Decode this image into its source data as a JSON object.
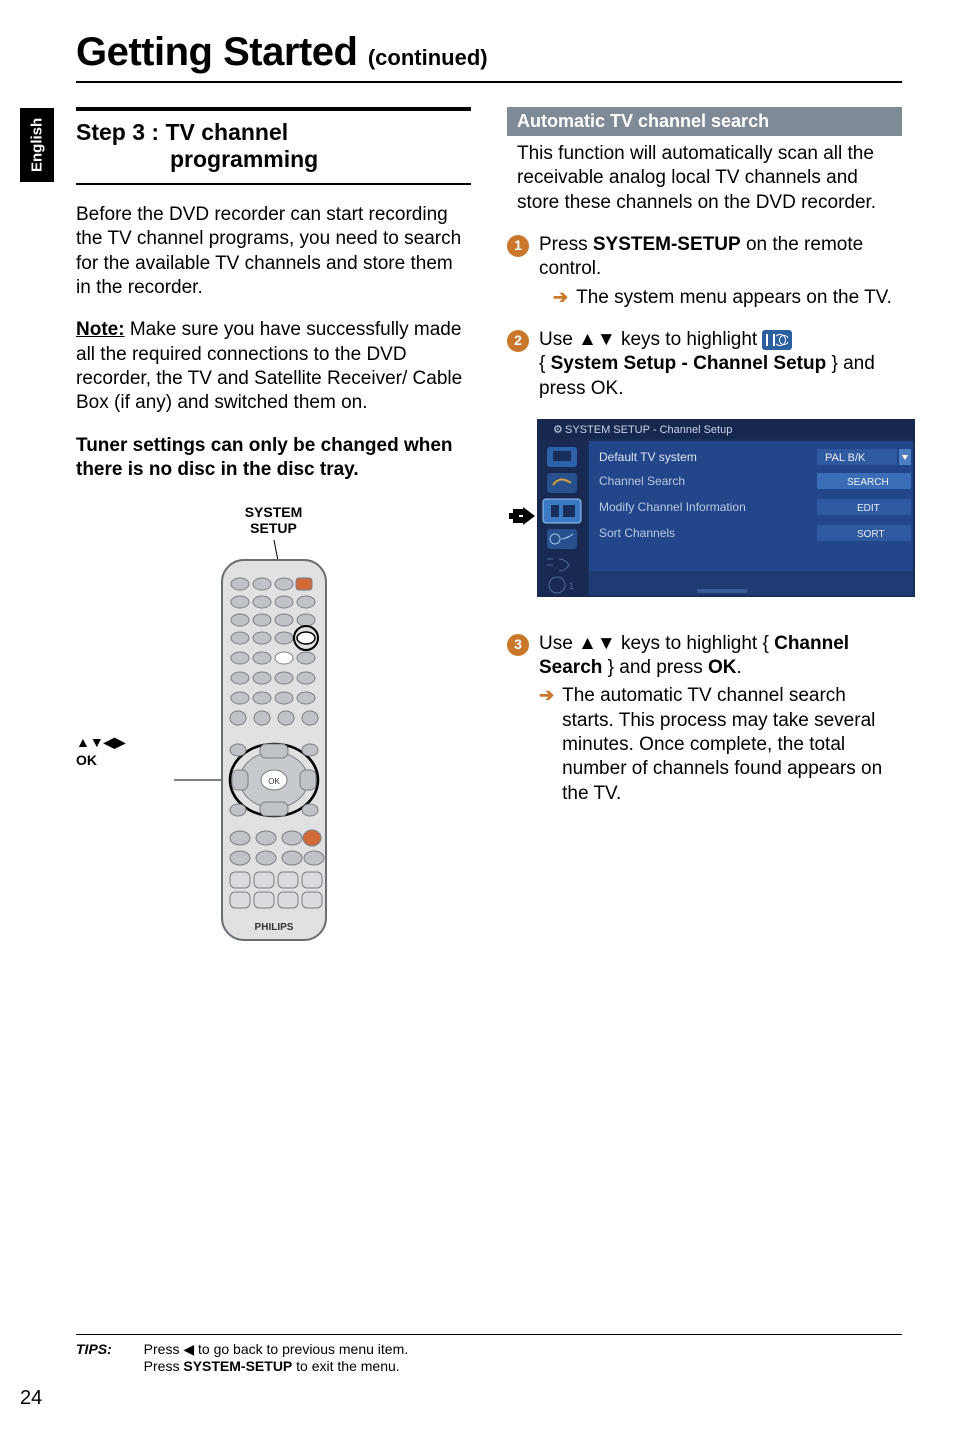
{
  "language_tab": "English",
  "title": {
    "main": "Getting Started",
    "continued": "(continued)"
  },
  "left": {
    "step_label_prefix": "Step 3 :",
    "step_title_1": "TV channel",
    "step_title_2": "programming",
    "intro": "Before the DVD recorder can start recording the TV channel programs, you need to search for the available TV channels and store them in the recorder.",
    "note_label": "Note:",
    "note_body": " Make sure you have successfully made all the required connections to the DVD recorder, the TV and Satellite Receiver/ Cable Box (if any) and switched them on.",
    "tuner_warning": "Tuner settings can only be changed when there is no disc in the disc tray.",
    "remote_top_label_1": "SYSTEM",
    "remote_top_label_2": "SETUP",
    "remote_left_label_1": "▲▼◀▶",
    "remote_left_label_2": "OK",
    "remote_brand": "PHILIPS"
  },
  "right": {
    "subheader": "Automatic TV channel search",
    "intro": "This function will automatically scan all the receivable analog local TV channels and store these channels on the DVD recorder.",
    "step1_a": "Press ",
    "step1_key": "SYSTEM-SETUP",
    "step1_b": " on the remote control.",
    "step1_result": "The system menu appears on the TV.",
    "step2_a": "Use ▲▼ keys to highlight ",
    "step2_b_prefix": "{ ",
    "step2_b_bold": "System Setup - Channel Setup",
    "step2_b_suffix": " } and press OK.",
    "step3_a": "Use ▲▼ keys to highlight { ",
    "step3_bold": "Channel Search",
    "step3_b": " } and press ",
    "step3_ok": "OK",
    "step3_c": ".",
    "step3_result": "The automatic TV channel search starts. This process may take several minutes. Once complete, the total number of channels found appears on the TV.",
    "menu": {
      "breadcrumb": "SYSTEM SETUP - Channel Setup",
      "rows": [
        {
          "label": "Default TV system",
          "value": "PAL B/K"
        },
        {
          "label": "Channel Search",
          "value": "SEARCH"
        },
        {
          "label": "Modify Channel Information",
          "value": "EDIT"
        },
        {
          "label": "Sort Channels",
          "value": "SORT"
        }
      ]
    }
  },
  "tips": {
    "label": "TIPS:",
    "line1_a": "Press ",
    "line1_arrow": "◀",
    "line1_b": " to go back to previous menu item.",
    "line2_a": "Press ",
    "line2_bold": "SYSTEM-SETUP",
    "line2_b": " to exit the menu."
  },
  "page_number": "24"
}
